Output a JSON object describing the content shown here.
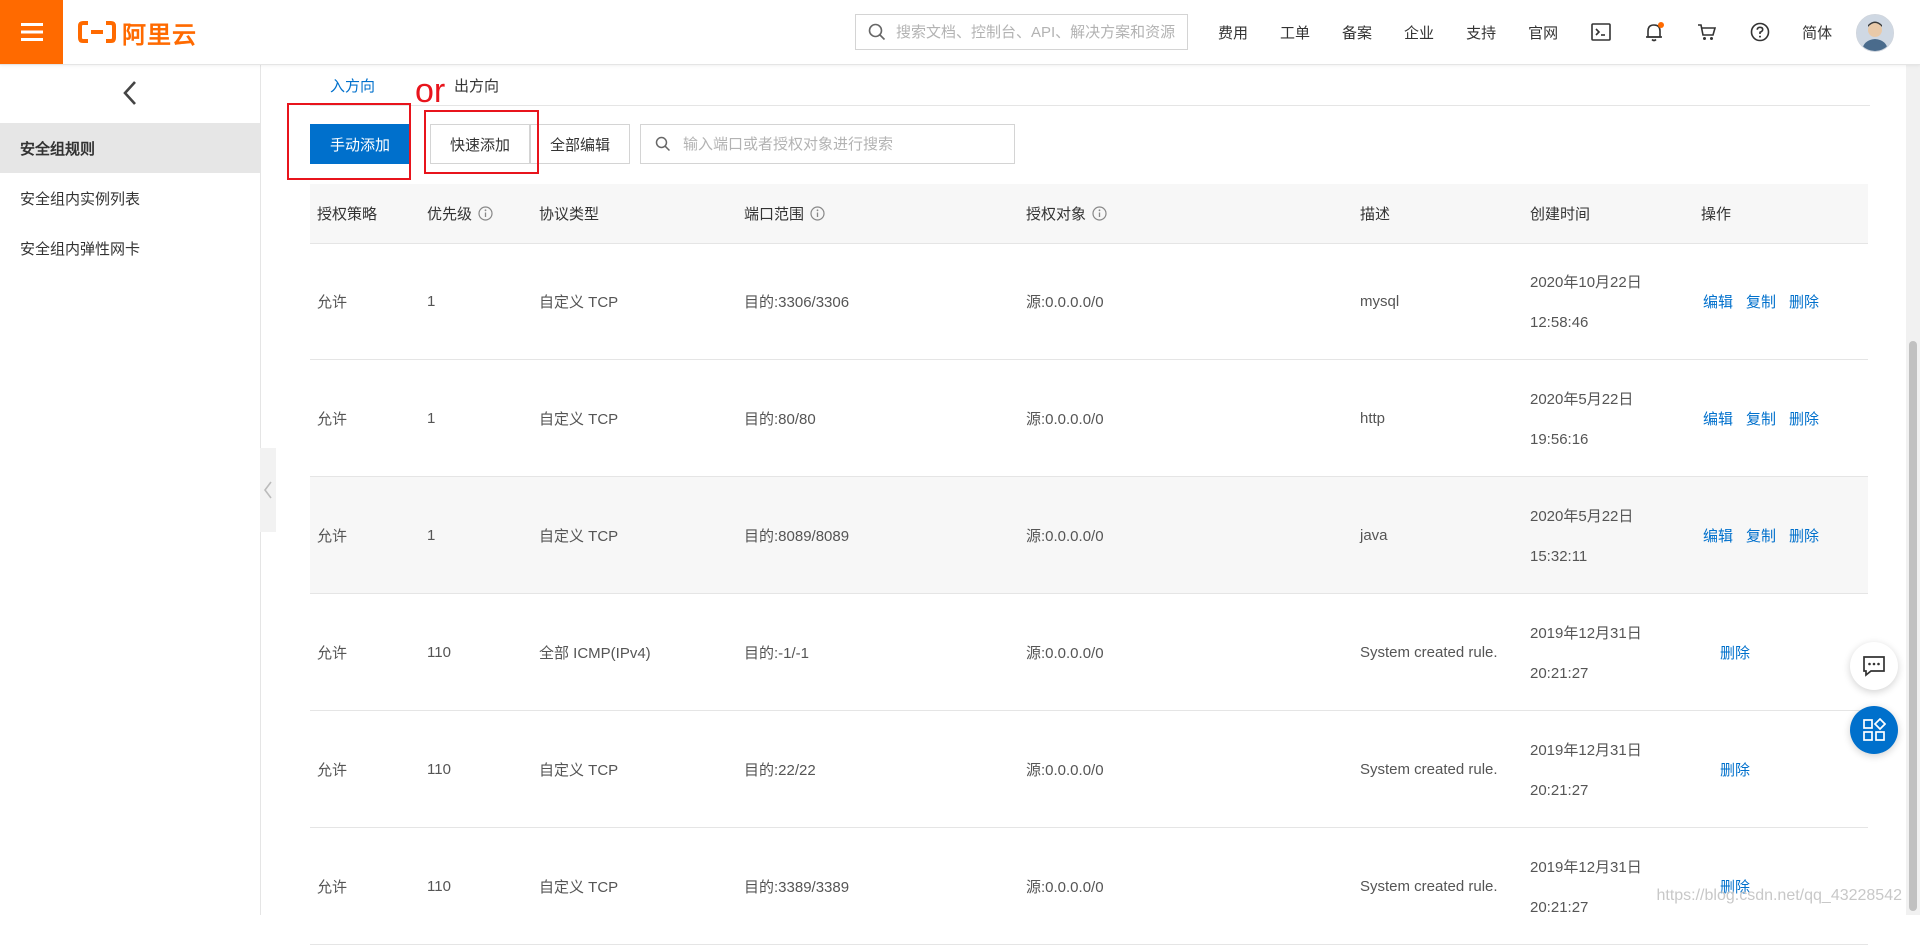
{
  "header": {
    "brand": "阿里云",
    "search_placeholder": "搜索文档、控制台、API、解决方案和资源",
    "nav": [
      "费用",
      "工单",
      "备案",
      "企业",
      "支持",
      "官网"
    ],
    "language": "简体",
    "icons": [
      "terminal-icon",
      "bell-icon",
      "cart-icon",
      "help-icon"
    ]
  },
  "sidebar": {
    "items": [
      {
        "label": "安全组规则",
        "active": true
      },
      {
        "label": "安全组内实例列表",
        "active": false
      },
      {
        "label": "安全组内弹性网卡",
        "active": false
      }
    ]
  },
  "tabs": [
    {
      "label": "入方向",
      "active": true
    },
    {
      "label": "出方向",
      "active": false
    }
  ],
  "toolbar": {
    "manual_add": "手动添加",
    "quick_add": "快速添加",
    "edit_all": "全部编辑",
    "search_placeholder": "输入端口或者授权对象进行搜索"
  },
  "annotation": {
    "or_text": "or"
  },
  "table": {
    "headers": [
      "授权策略",
      "优先级",
      "协议类型",
      "端口范围",
      "授权对象",
      "描述",
      "创建时间",
      "操作"
    ],
    "rows": [
      {
        "policy": "允许",
        "priority": "1",
        "protocol": "自定义 TCP",
        "port": "目的:3306/3306",
        "source": "源:0.0.0.0/0",
        "desc": "mysql",
        "date": "2020年10月22日",
        "time": "12:58:46",
        "actions": [
          "编辑",
          "复制",
          "删除"
        ]
      },
      {
        "policy": "允许",
        "priority": "1",
        "protocol": "自定义 TCP",
        "port": "目的:80/80",
        "source": "源:0.0.0.0/0",
        "desc": "http",
        "date": "2020年5月22日",
        "time": "19:56:16",
        "actions": [
          "编辑",
          "复制",
          "删除"
        ]
      },
      {
        "policy": "允许",
        "priority": "1",
        "protocol": "自定义 TCP",
        "port": "目的:8089/8089",
        "source": "源:0.0.0.0/0",
        "desc": "java",
        "date": "2020年5月22日",
        "time": "15:32:11",
        "actions": [
          "编辑",
          "复制",
          "删除"
        ]
      },
      {
        "policy": "允许",
        "priority": "110",
        "protocol": "全部 ICMP(IPv4)",
        "port": "目的:-1/-1",
        "source": "源:0.0.0.0/0",
        "desc": "System created rule.",
        "date": "2019年12月31日",
        "time": "20:21:27",
        "actions": [
          "删除"
        ]
      },
      {
        "policy": "允许",
        "priority": "110",
        "protocol": "自定义 TCP",
        "port": "目的:22/22",
        "source": "源:0.0.0.0/0",
        "desc": "System created rule.",
        "date": "2019年12月31日",
        "time": "20:21:27",
        "actions": [
          "删除"
        ]
      },
      {
        "policy": "允许",
        "priority": "110",
        "protocol": "自定义 TCP",
        "port": "目的:3389/3389",
        "source": "源:0.0.0.0/0",
        "desc": "System created rule.",
        "date": "2019年12月31日",
        "time": "20:21:27",
        "actions": [
          "删除"
        ]
      }
    ]
  },
  "watermark": "https://blog.csdn.net/qq_43228542",
  "colors": {
    "brand": "#ff6a00",
    "primary": "#0070cc",
    "annotation": "#e8141c"
  }
}
